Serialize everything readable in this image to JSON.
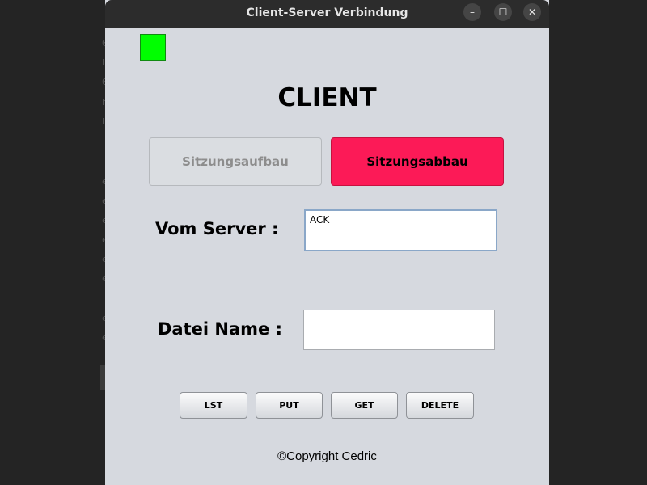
{
  "window": {
    "title": "Client-Server Verbindung",
    "controls": {
      "minimize": "–",
      "maximize": "☐",
      "close": "✕"
    }
  },
  "status_indicator": {
    "color": "#00ff00"
  },
  "heading": "CLIENT",
  "session_buttons": {
    "connect_label": "Sitzungsaufbau",
    "disconnect_label": "Sitzungsabbau",
    "disconnect_color": "#fc1a57"
  },
  "server_response": {
    "label": "Vom Server  :",
    "value": "ACK"
  },
  "file_name": {
    "label": "Datei Name :",
    "value": ""
  },
  "commands": {
    "lst": "LST",
    "put": "PUT",
    "get": "GET",
    "delete": "DELETE"
  },
  "footer": {
    "copyright": "©Copyright   Cedric"
  }
}
